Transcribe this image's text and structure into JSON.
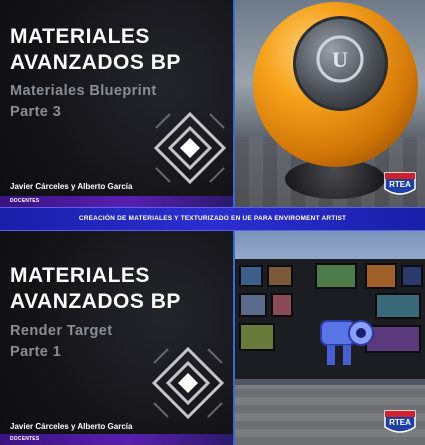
{
  "thumbnails": [
    {
      "title_line1": "MATERIALES",
      "title_line2": "AVANZADOS BP",
      "subtitle_line1": "Materiales Blueprint",
      "subtitle_line2": "Parte 3",
      "authors": "Javier Cárceles y Alberto García",
      "role": "DOCENTES",
      "badge": "RTEA"
    },
    {
      "title_line1": "MATERIALES",
      "title_line2": "AVANZADOS BP",
      "subtitle_line1": "Render Target",
      "subtitle_line2": "Parte 1",
      "authors": "Javier Cárceles y Alberto García",
      "role": "DOCENTES",
      "badge": "RTEA"
    }
  ],
  "banner": {
    "text": "CREACIÓN DE MATERIALES  Y TEXTURIZADO EN UE PARA ENVIROMENT ARTIST"
  },
  "icons": {
    "deco_logo": "diamond-logo-icon",
    "badge": "rtea-badge-icon",
    "sphere_mark": "unreal-engine-logo-icon"
  },
  "colors": {
    "accent_blue": "#2b2fd0",
    "docentes_purple": "#5a1fb0",
    "sphere_orange": "#f6a21c"
  }
}
